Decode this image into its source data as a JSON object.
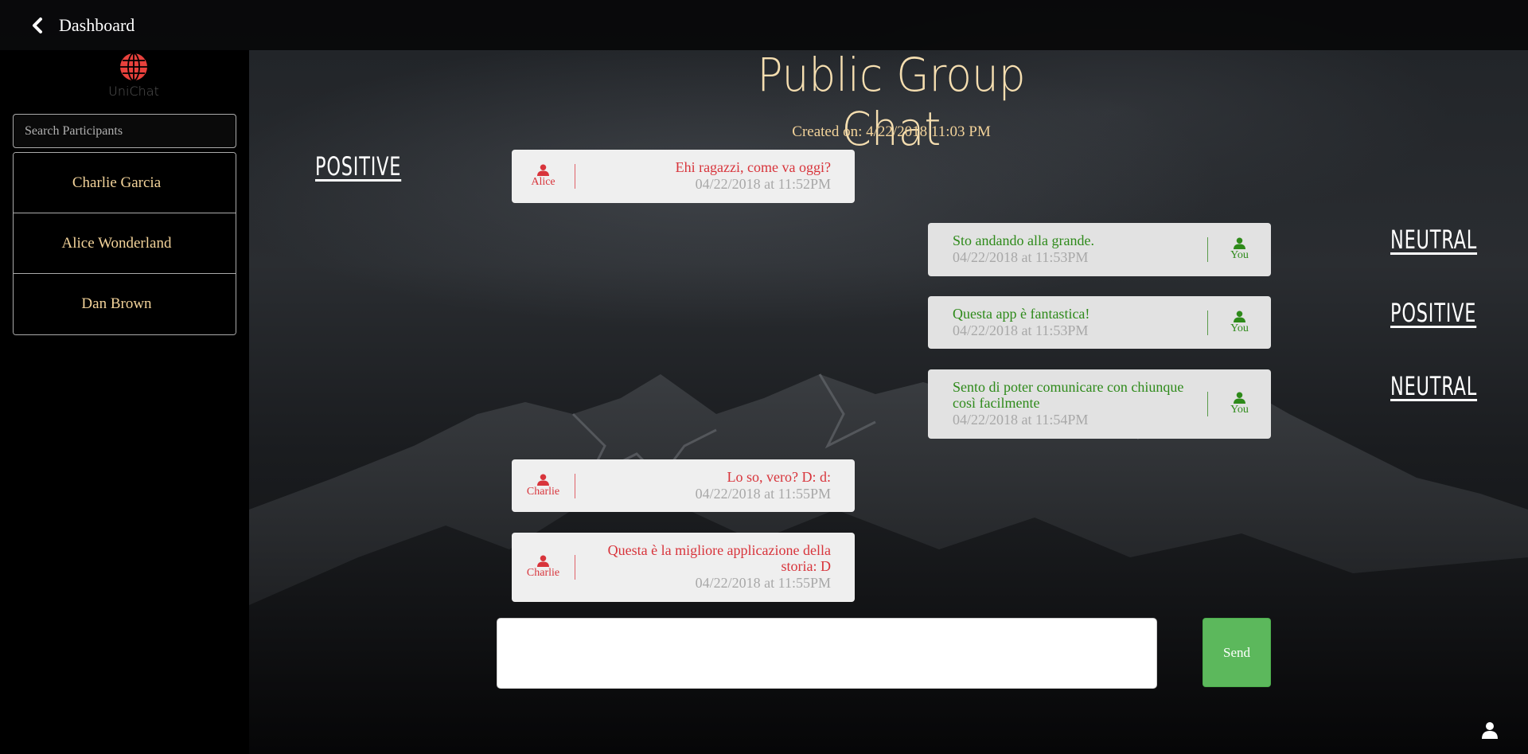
{
  "topbar": {
    "back_icon": "chevron-left-icon",
    "title": "Dashboard"
  },
  "sidebar": {
    "logo_icon": "globe-icon",
    "logo_text": "UniChat",
    "logo_color": "#e8413c",
    "search_placeholder": "Search Participants",
    "participants": [
      "Charlie Garcia",
      "Alice Wonderland",
      "Dan Brown"
    ]
  },
  "chat": {
    "title": "Public Group Chat",
    "created": "Created on: 4/22/2018 11:03 PM",
    "messages": [
      {
        "side": "left",
        "sender": "Alice",
        "text": "Ehi ragazzi, come va oggi?",
        "time": "04/22/2018 at 11:52PM",
        "sentiment": "POSITIVE"
      },
      {
        "side": "right",
        "sender": "You",
        "text": "Sto andando alla grande.",
        "time": "04/22/2018 at 11:53PM",
        "sentiment": "NEUTRAL"
      },
      {
        "side": "right",
        "sender": "You",
        "text": "Questa app è fantastica!",
        "time": "04/22/2018 at 11:53PM",
        "sentiment": "POSITIVE"
      },
      {
        "side": "right",
        "sender": "You",
        "text": "Sento di poter comunicare con chiunque così facilmente",
        "time": "04/22/2018 at 11:54PM",
        "sentiment": "NEUTRAL"
      },
      {
        "side": "left",
        "sender": "Charlie",
        "text": "Lo so, vero? D: d:",
        "time": "04/22/2018 at 11:55PM"
      },
      {
        "side": "left",
        "sender": "Charlie",
        "text": "Questa è la migliore applicazione della storia: D",
        "time": "04/22/2018 at 11:55PM"
      }
    ],
    "incoming_color": "#d8343b",
    "outgoing_color": "#2e8a1a"
  },
  "composer": {
    "value": "",
    "send_label": "Send",
    "send_color": "#5cb85c"
  },
  "footer": {
    "profile_icon": "user-icon"
  }
}
